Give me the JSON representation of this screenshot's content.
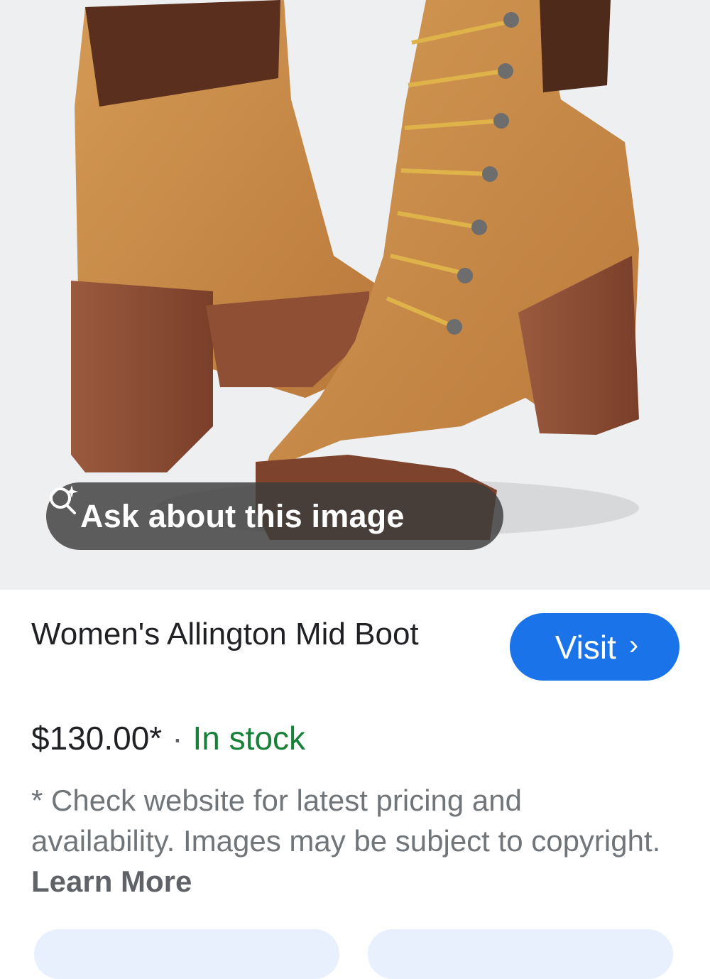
{
  "image_overlay": {
    "ask_label": "Ask about this image",
    "ask_icon": "lens-sparkle-icon"
  },
  "product": {
    "title": "Women's Allington Mid Boot",
    "price": "$130.00*",
    "separator": "·",
    "stock": "In stock",
    "disclaimer": "* Check website for latest pricing and availability. Images may be subject to copyright.",
    "learn_more": "Learn More"
  },
  "actions": {
    "visit_label": "Visit",
    "visit_chevron": "›"
  },
  "colors": {
    "accent": "#1a73e8",
    "in_stock": "#188038",
    "chip_bg": "#e8f0fe"
  }
}
